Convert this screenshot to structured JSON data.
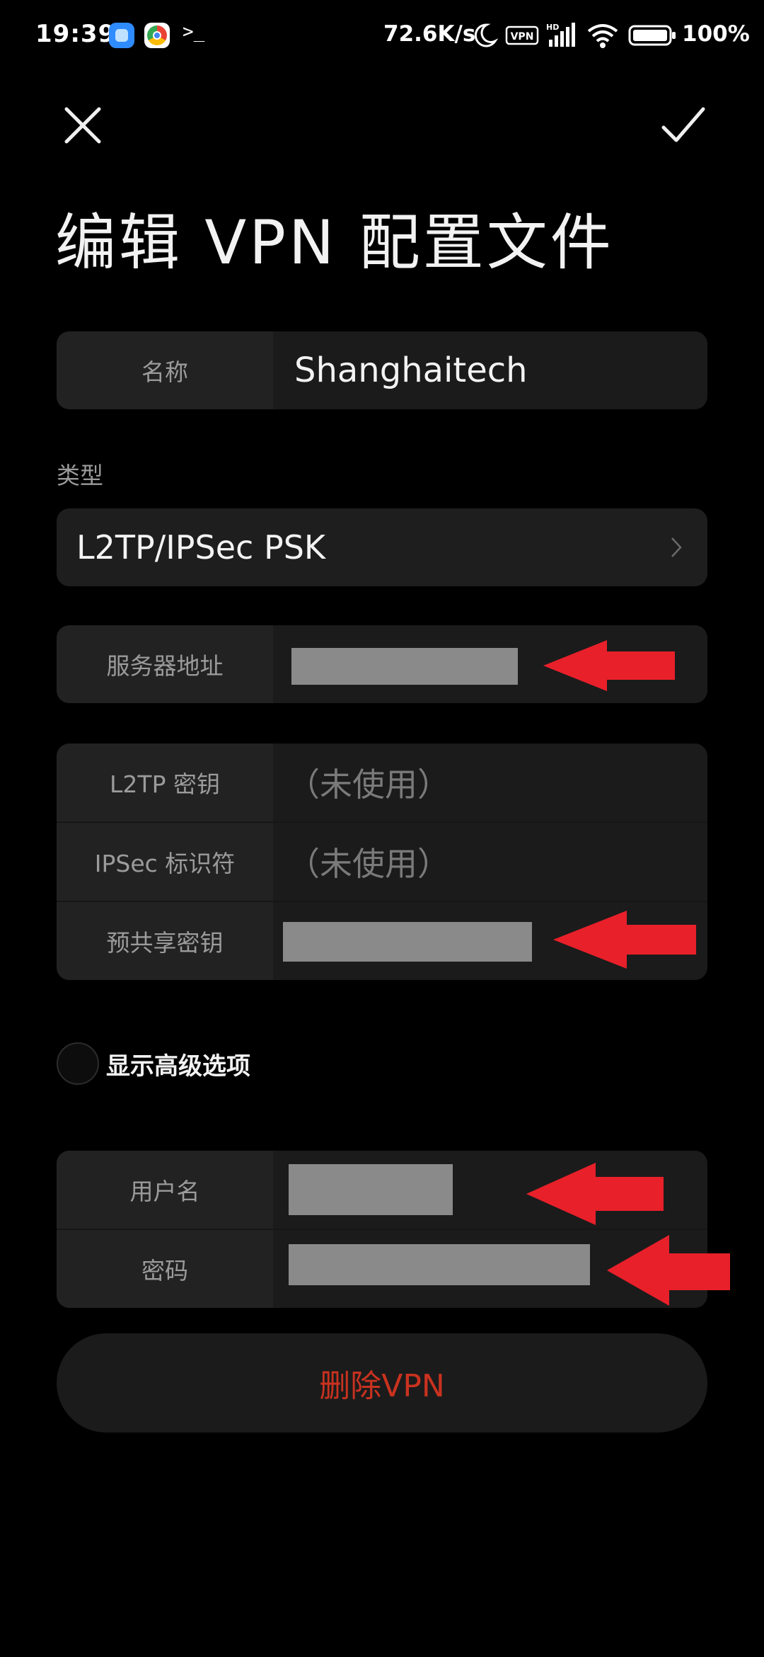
{
  "status_bar": {
    "time": "19:39",
    "terminal_glyph": ">_",
    "net_speed": "72.6K/s",
    "vpn_badge": "VPN",
    "hd_badge": "HD",
    "battery_pct": "100%",
    "icons": [
      "app-icon-blue",
      "chrome-icon",
      "terminal-icon",
      "moon-icon",
      "vpn-icon",
      "signal-icon",
      "wifi-icon",
      "battery-icon"
    ]
  },
  "header": {
    "title": "编辑 VPN 配置文件",
    "close_icon": "close-icon",
    "confirm_icon": "check-icon"
  },
  "name_row": {
    "label": "名称",
    "value": "Shanghaitech"
  },
  "type": {
    "section_label": "类型",
    "value": "L2TP/IPSec PSK"
  },
  "server_row": {
    "label": "服务器地址",
    "value": ""
  },
  "keys": [
    {
      "label": "L2TP 密钥",
      "value": "（未使用）"
    },
    {
      "label": "IPSec 标识符",
      "value": "（未使用）"
    },
    {
      "label": "预共享密钥",
      "value": ""
    }
  ],
  "advanced": {
    "label": "显示高级选项",
    "checked": false
  },
  "credentials": [
    {
      "label": "用户名",
      "value": ""
    },
    {
      "label": "密码",
      "value": ""
    }
  ],
  "delete_button": {
    "label": "删除VPN"
  },
  "colors": {
    "background": "#000000",
    "card": "#1e1e1e",
    "label": "#9b9b9b",
    "delete_text": "#c9321f",
    "annotation_arrow": "#e8202a",
    "redaction": "#8a8a8a"
  }
}
